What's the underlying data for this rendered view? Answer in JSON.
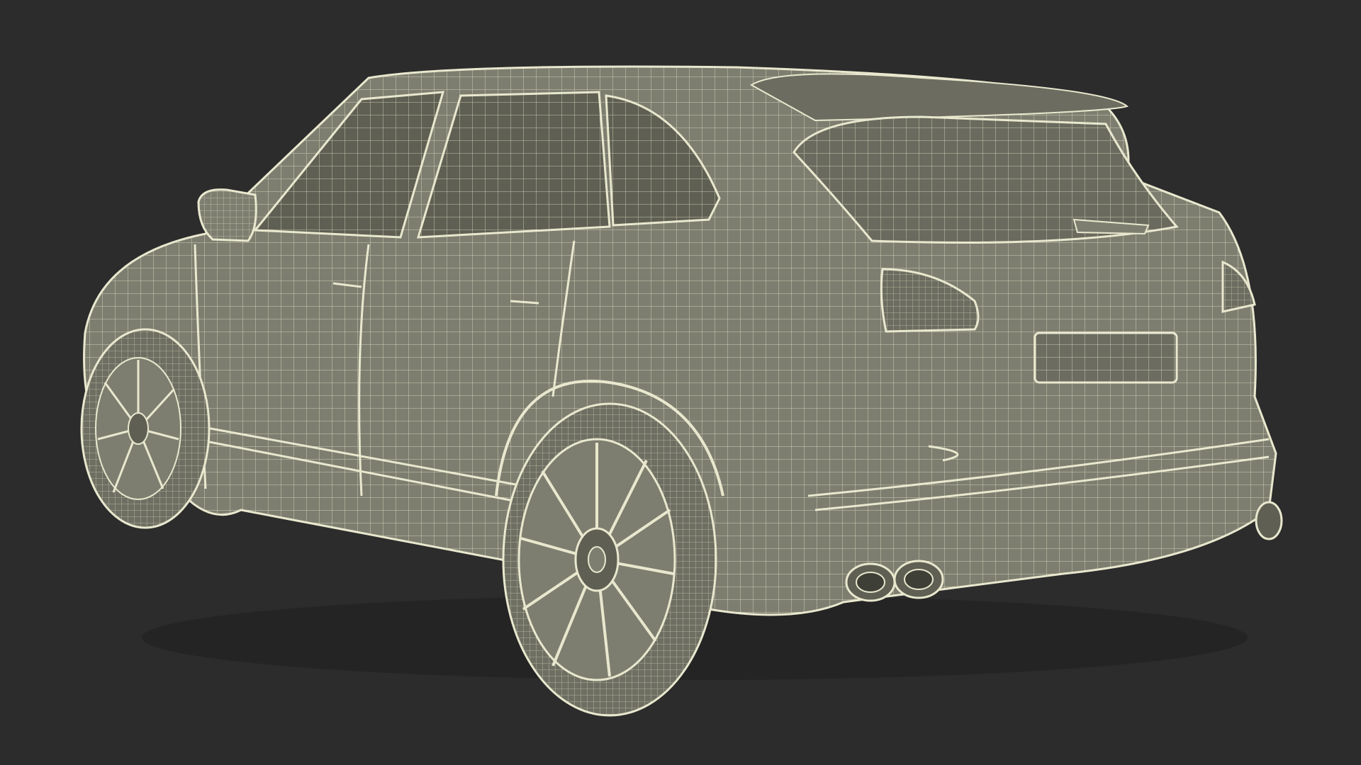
{
  "scene": {
    "subject": "suv-wireframe-render",
    "background_color": "#2c2c2c",
    "surface_color": "#7d7e6f",
    "surface_dark_color": "#5f6053",
    "wire_color": "#e9e8cf",
    "tire_color": "#6e6f62"
  }
}
